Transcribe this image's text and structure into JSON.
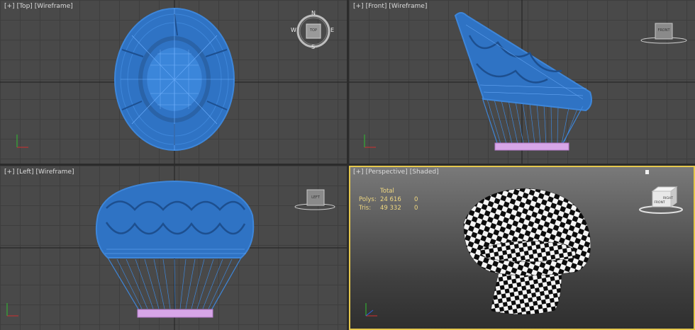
{
  "viewports": {
    "top": {
      "plus": "[+]",
      "view": "[Top]",
      "mode": "[Wireframe]",
      "compass": {
        "n": "N",
        "s": "S",
        "e": "E",
        "w": "W",
        "cube": "TOP"
      }
    },
    "front": {
      "plus": "[+]",
      "view": "[Front]",
      "mode": "[Wireframe]",
      "cube": "FRONT"
    },
    "left": {
      "plus": "[+]",
      "view": "[Left]",
      "mode": "[Wireframe]",
      "cube": "LEFT"
    },
    "perspective": {
      "plus": "[+]",
      "view": "[Perspective]",
      "mode": "[Shaded]",
      "cube_right": "RIGHT",
      "cube_front": "FRONT",
      "stats": {
        "header": "Total",
        "polys_label": "Polys:",
        "polys_total": "24 616",
        "polys_sel": "0",
        "tris_label": "Tris:",
        "tris_total": "49 332",
        "tris_sel": "0"
      }
    }
  },
  "colors": {
    "wire": "#3e86d9",
    "wire_light": "#6fb0ff",
    "base": "#d7a6e8",
    "active_border": "#e5c84d"
  }
}
